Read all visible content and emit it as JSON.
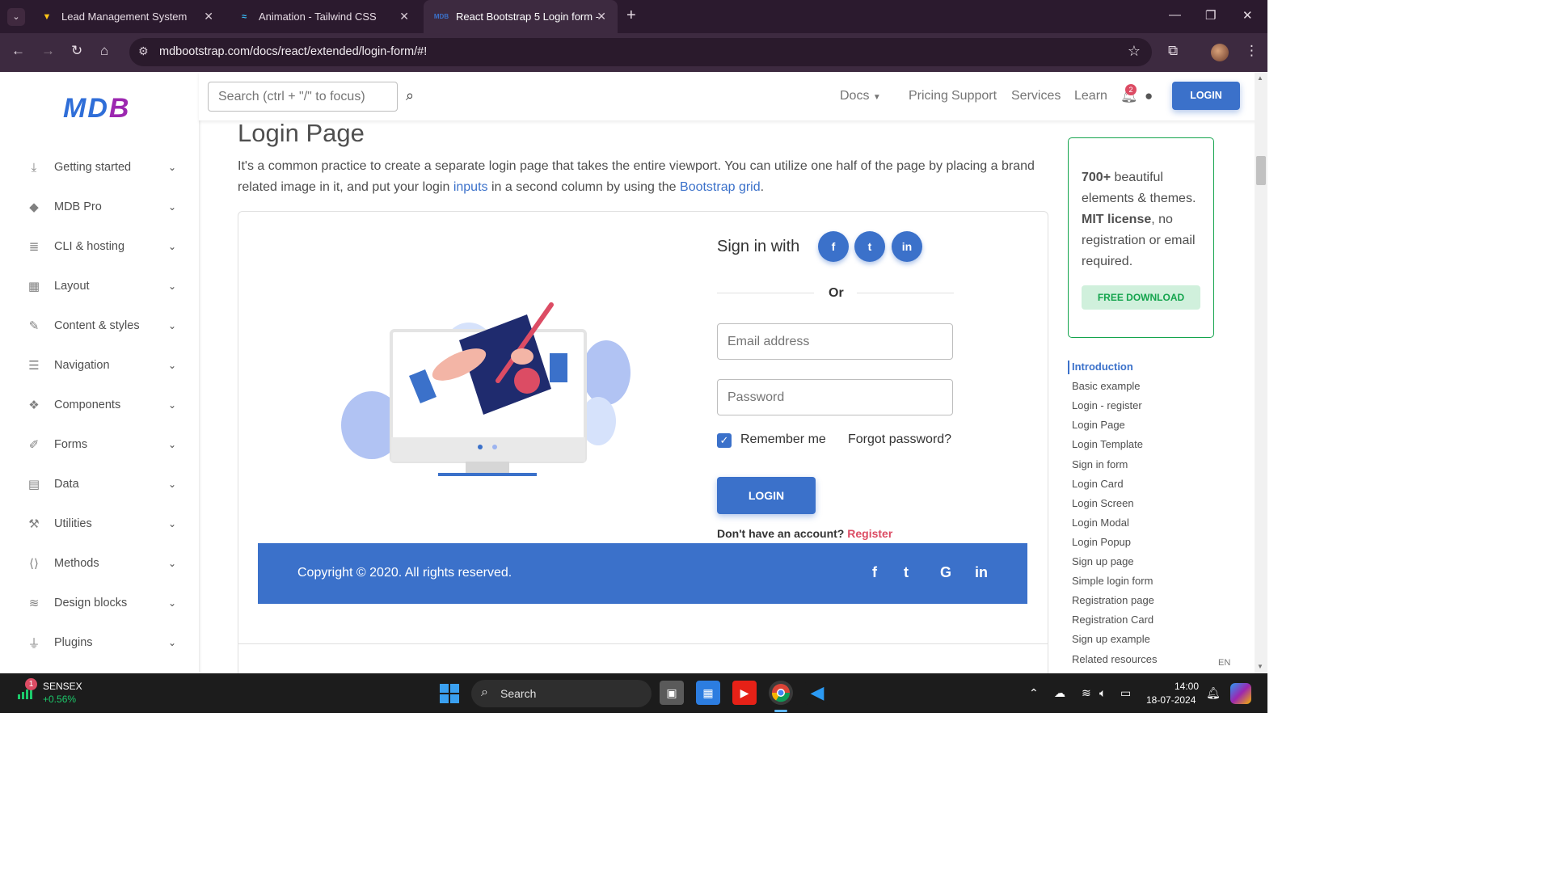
{
  "browser": {
    "tabs": [
      {
        "title": "Lead Management System",
        "favicon": "vite-icon"
      },
      {
        "title": "Animation - Tailwind CSS",
        "favicon": "tailwind-icon"
      },
      {
        "title": "React Bootstrap 5 Login form -",
        "favicon": "mdb-icon",
        "favicon_text": "MDB"
      }
    ],
    "url": "mdbootstrap.com/docs/react/extended/login-form/#!"
  },
  "site": {
    "logo": {
      "m": "MD",
      "b": "B"
    },
    "search_placeholder": "Search (ctrl + \"/\" to focus)",
    "nav": {
      "docs": "Docs",
      "pricing": "Pricing",
      "support": "Support",
      "services": "Services",
      "learn": "Learn",
      "login": "LOGIN"
    },
    "notifications": "2"
  },
  "sidebar": {
    "items": [
      {
        "label": "Getting started",
        "icon": "download-icon"
      },
      {
        "label": "MDB Pro",
        "icon": "gem-icon"
      },
      {
        "label": "CLI & hosting",
        "icon": "database-icon"
      },
      {
        "label": "Layout",
        "icon": "grid-icon"
      },
      {
        "label": "Content & styles",
        "icon": "brush-icon"
      },
      {
        "label": "Navigation",
        "icon": "menu-icon"
      },
      {
        "label": "Components",
        "icon": "cubes-icon"
      },
      {
        "label": "Forms",
        "icon": "edit-icon"
      },
      {
        "label": "Data",
        "icon": "table-icon"
      },
      {
        "label": "Utilities",
        "icon": "wrench-icon"
      },
      {
        "label": "Methods",
        "icon": "code-icon"
      },
      {
        "label": "Design blocks",
        "icon": "layers-icon"
      },
      {
        "label": "Plugins",
        "icon": "plug-icon"
      }
    ]
  },
  "content": {
    "title": "Login Page",
    "lead_1": "It's a common practice to create a separate login page that takes the entire viewport. You can utilize one half of the page by placing a brand related image in it, and put your login ",
    "lead_link_1": "inputs",
    "lead_2": " in a second column by using the ",
    "lead_link_2": "Bootstrap grid",
    "lead_3": "."
  },
  "login_form": {
    "sign_in_with": "Sign in with",
    "social": [
      "f",
      "t",
      "in"
    ],
    "or": "Or",
    "email_placeholder": "Email address",
    "password_placeholder": "Password",
    "remember": "Remember me",
    "remember_checked": true,
    "forgot": "Forgot password?",
    "login": "LOGIN",
    "no_account": "Don't have an account?",
    "register": "Register"
  },
  "footer": {
    "copyright": "Copyright © 2020. All rights reserved.",
    "icons": [
      "f",
      "t",
      "G",
      "in"
    ]
  },
  "promo": {
    "count": "700+",
    "text_1": " beautiful elements & themes. ",
    "license": "MIT license",
    "text_2": ", no registration or email required.",
    "download": "FREE DOWNLOAD"
  },
  "toc": [
    {
      "label": "Introduction",
      "active": true
    },
    {
      "label": "Basic example"
    },
    {
      "label": "Login - register"
    },
    {
      "label": "Login Page"
    },
    {
      "label": "Login Template"
    },
    {
      "label": "Sign in form"
    },
    {
      "label": "Login Card"
    },
    {
      "label": "Login Screen"
    },
    {
      "label": "Login Modal"
    },
    {
      "label": "Login Popup"
    },
    {
      "label": "Sign up page"
    },
    {
      "label": "Simple login form"
    },
    {
      "label": "Registration page"
    },
    {
      "label": "Registration Card"
    },
    {
      "label": "Sign up example"
    },
    {
      "label": "Related resources"
    }
  ],
  "lang": "EN",
  "taskbar": {
    "stock_name": "SENSEX",
    "stock_change": "+0.56%",
    "stock_badge": "1",
    "search": "Search",
    "time": "14:00",
    "date": "18-07-2024"
  },
  "colors": {
    "primary": "#3b71ca",
    "danger": "#dc4c64",
    "success": "#14a44d",
    "chrome": "#3d2a40"
  }
}
